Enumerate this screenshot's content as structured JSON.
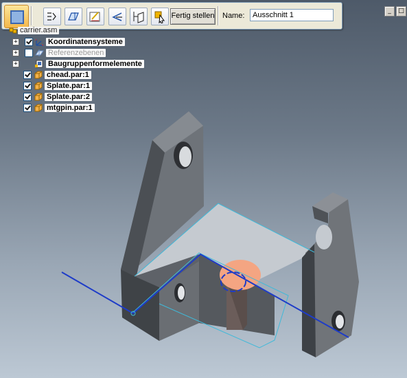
{
  "toolbar": {
    "main_tool_icon": "section-view-icon",
    "buttons": [
      {
        "name": "step-select-icon"
      },
      {
        "name": "reference-plane-icon"
      },
      {
        "name": "sketch-profile-icon"
      },
      {
        "name": "side-direction-icon"
      },
      {
        "name": "extent-icon"
      },
      {
        "name": "select-parts-icon"
      }
    ],
    "finish_label": "Fertig stellen",
    "name_label": "Name:",
    "name_value": "Ausschnitt 1"
  },
  "tree": {
    "root_label": "carrier.asm",
    "items": [
      {
        "label": "Koordinatensysteme",
        "expand": "+",
        "checked": true,
        "icon": "coordinate-system-icon"
      },
      {
        "label": "Referenzebenen",
        "expand": "+",
        "checked": false,
        "icon": "reference-plane-icon"
      },
      {
        "label": "Baugruppenformelemente",
        "expand": "+",
        "checked": null,
        "icon": "assembly-features-icon"
      },
      {
        "label": "chead.par:1",
        "expand": "",
        "checked": true,
        "icon": "part-icon"
      },
      {
        "label": "Splate.par:1",
        "expand": "",
        "checked": true,
        "icon": "part-icon"
      },
      {
        "label": "Splate.par:2",
        "expand": "",
        "checked": true,
        "icon": "part-icon"
      },
      {
        "label": "mtgpin.par:1",
        "expand": "",
        "checked": true,
        "icon": "part-icon"
      }
    ]
  },
  "colors": {
    "part_face_top": "#c9ced4",
    "part_face_side": "#5d6166",
    "section_line": "#1e3cc8",
    "pin_top": "#f4a582"
  }
}
